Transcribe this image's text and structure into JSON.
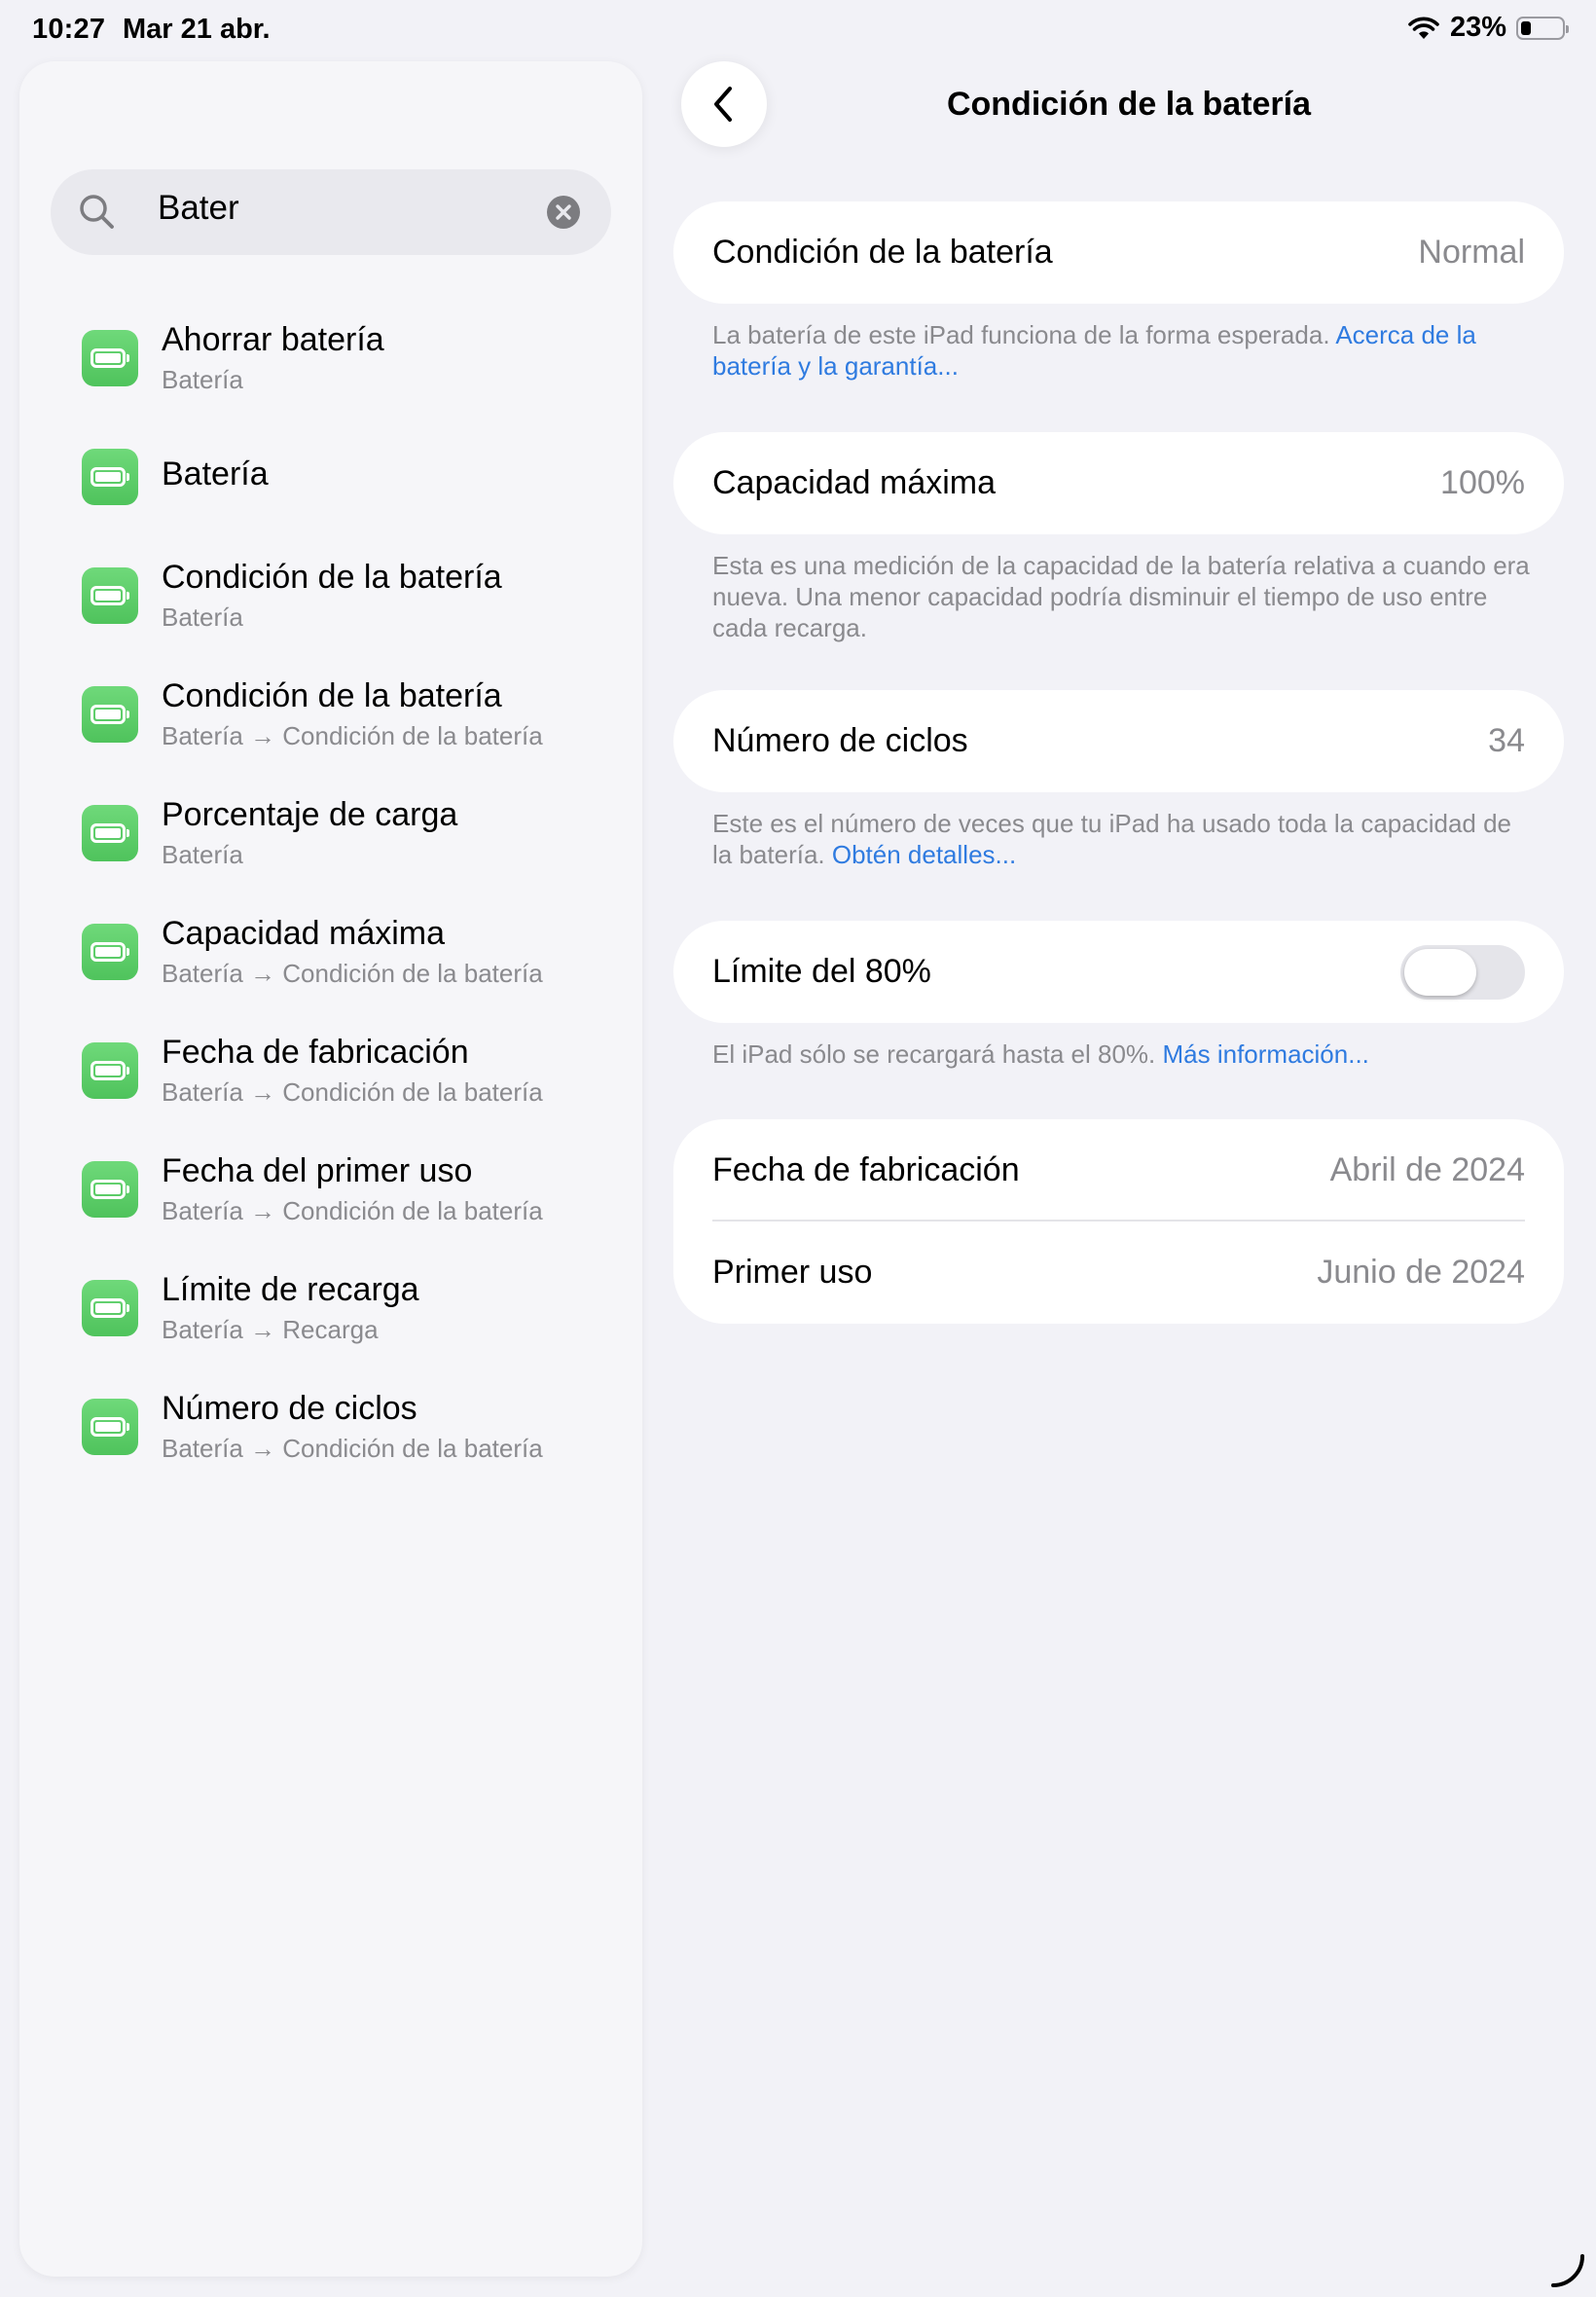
{
  "status_bar": {
    "time": "10:27",
    "date": "Mar 21 abr.",
    "battery_percent": "23%",
    "battery_level": 0.23
  },
  "sidebar": {
    "search": {
      "value": "Bater"
    },
    "results": [
      {
        "title": "Ahorrar batería",
        "subtitle": "Batería"
      },
      {
        "title": "Batería",
        "subtitle": ""
      },
      {
        "title": "Condición de la batería",
        "subtitle": "Batería"
      },
      {
        "title": "Condición de la batería",
        "subtitle": "Batería → Condición de la batería"
      },
      {
        "title": "Porcentaje de carga",
        "subtitle": "Batería"
      },
      {
        "title": "Capacidad máxima",
        "subtitle": "Batería → Condición de la batería"
      },
      {
        "title": "Fecha de fabricación",
        "subtitle": "Batería → Condición de la batería"
      },
      {
        "title": "Fecha del primer uso",
        "subtitle": "Batería → Condición de la batería"
      },
      {
        "title": "Límite de recarga",
        "subtitle": "Batería → Recarga"
      },
      {
        "title": "Número de ciclos",
        "subtitle": "Batería → Condición de la batería"
      }
    ]
  },
  "main": {
    "title": "Condición de la batería",
    "condition": {
      "label": "Condición de la batería",
      "value": "Normal",
      "footer_text": "La batería de este iPad funciona de la forma esperada. ",
      "footer_link": "Acerca de la batería y la garantía..."
    },
    "capacity": {
      "label": "Capacidad máxima",
      "value": "100%",
      "footer_text": "Esta es una medición de la capacidad de la batería relativa a cuando era nueva. Una menor capacidad podría disminuir el tiempo de uso entre cada recarga."
    },
    "cycles": {
      "label": "Número de ciclos",
      "value": "34",
      "footer_text": "Este es el número de veces que tu iPad ha usado toda la capacidad de la batería. ",
      "footer_link": "Obtén detalles..."
    },
    "limit": {
      "label": "Límite del 80%",
      "enabled": false,
      "footer_text": "El iPad sólo se recargará hasta el 80%. ",
      "footer_link": "Más información..."
    },
    "dates": {
      "manufacture_label": "Fecha de fabricación",
      "manufacture_value": "Abril de 2024",
      "first_use_label": "Primer uso",
      "first_use_value": "Junio de 2024"
    }
  }
}
